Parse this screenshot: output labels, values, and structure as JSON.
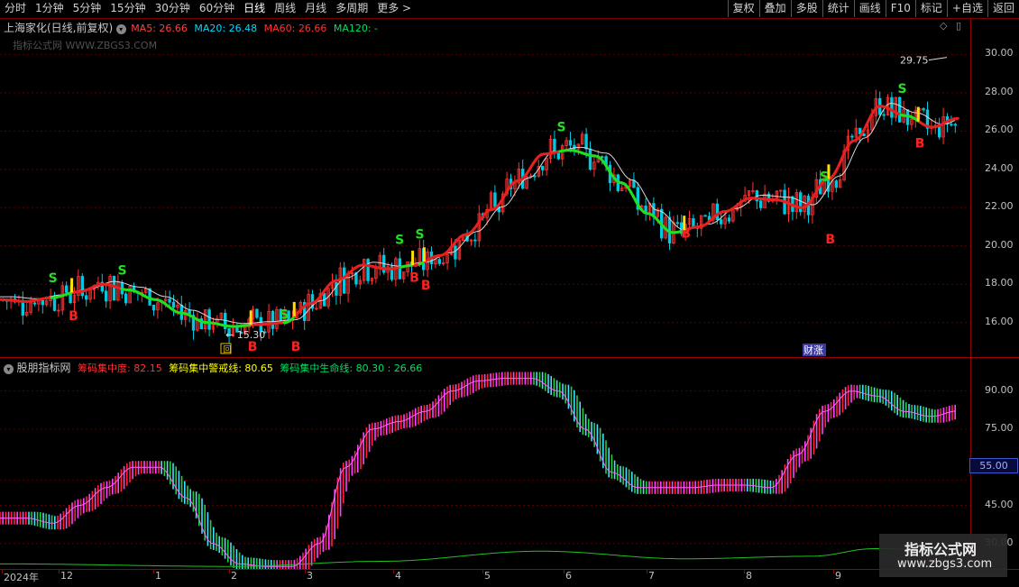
{
  "toolbar": {
    "left": [
      "分时",
      "1分钟",
      "5分钟",
      "15分钟",
      "30分钟",
      "60分钟",
      "日线",
      "周线",
      "月线",
      "多周期",
      "更多 >"
    ],
    "active": "日线",
    "right": [
      "复权",
      "叠加",
      "多股",
      "统计",
      "画线",
      "F10",
      "标记",
      "+自选",
      "返回"
    ]
  },
  "main_legend": {
    "title": "上海家化(日线,前复权)",
    "ma5": "MA5: 26.66",
    "ma20": "MA20: 26.48",
    "ma60": "MA60: 26.66",
    "ma120": "MA120: -",
    "site_watermark": "指标公式网 WWW.ZBGS3.COM",
    "colors": {
      "ma5": "#ff4040",
      "ma20": "#00d8ff",
      "ma60": "#ff3030",
      "ma120": "#00e060"
    }
  },
  "price_axis": {
    "ticks": [
      "30.00",
      "28.00",
      "26.00",
      "24.00",
      "22.00",
      "20.00",
      "18.00",
      "16.00"
    ],
    "range": [
      14.2,
      31.9
    ]
  },
  "annotations": {
    "high": "29.75",
    "low": "15.30",
    "news_tag": "财",
    "news_tag2": "涨",
    "square_marker": "回"
  },
  "signals": {
    "buy": [
      [
        "2024-12-10",
        16.7
      ],
      [
        "2025-02-10",
        15.1
      ],
      [
        "2025-02-25",
        15.1
      ],
      [
        "2025-04-07",
        18.7
      ],
      [
        "2025-04-11",
        18.3
      ],
      [
        "2025-07-10",
        21.0
      ],
      [
        "2025-08-29",
        20.7
      ],
      [
        "2025-09-29",
        25.7
      ]
    ],
    "sell": [
      [
        "2024-12-03",
        18.1
      ],
      [
        "2024-12-27",
        18.5
      ],
      [
        "2025-02-21",
        16.2
      ],
      [
        "2025-04-02",
        20.1
      ],
      [
        "2025-04-09",
        20.4
      ],
      [
        "2025-05-28",
        26.0
      ],
      [
        "2025-08-27",
        23.4
      ],
      [
        "2025-09-23",
        28.0
      ]
    ]
  },
  "indicator_legend": {
    "name": "股朋指标网",
    "l1": "筹码集中度: 82.15",
    "l2": "筹码集中警戒线: 80.65",
    "l3": "筹码集中生命线: 80.30 : 26.66"
  },
  "indicator_axis": {
    "ticks": [
      "90.00",
      "75.00",
      "45.00",
      "30.00"
    ],
    "highlight": "55.00",
    "range": [
      20,
      103
    ]
  },
  "dates": {
    "items": [
      "2024年",
      "12",
      "1",
      "2",
      "3",
      "4",
      "5",
      "6",
      "7",
      "8",
      "9"
    ]
  },
  "watermark": {
    "line1": "指标公式网",
    "line2": "www.zbgs3.com"
  },
  "chart_data": {
    "type": "line",
    "series": [
      {
        "name": "MA60",
        "values": [
          17.2,
          17.1,
          17.3,
          17.6,
          18.0,
          17.7,
          17.2,
          16.5,
          16.0,
          15.8,
          15.9,
          16.0,
          17.0,
          18.2,
          19.0,
          18.8,
          19.0,
          19.5,
          20.6,
          21.9,
          23.4,
          24.8,
          25.0,
          24.7,
          23.3,
          21.7,
          20.7,
          21.0,
          21.8,
          22.5,
          22.4,
          22.0,
          23.5,
          25.5,
          27.3,
          26.8,
          26.2,
          26.66
        ]
      },
      {
        "name": "筹码集中度",
        "values": [
          40,
          40,
          38,
          45,
          52,
          60,
          60,
          48,
          30,
          22,
          21,
          21,
          30,
          60,
          75,
          78,
          82,
          90,
          94,
          95,
          95,
          90,
          75,
          58,
          52,
          52,
          52,
          53,
          53,
          52,
          65,
          82,
          90,
          88,
          82,
          80,
          82.15
        ]
      }
    ]
  }
}
